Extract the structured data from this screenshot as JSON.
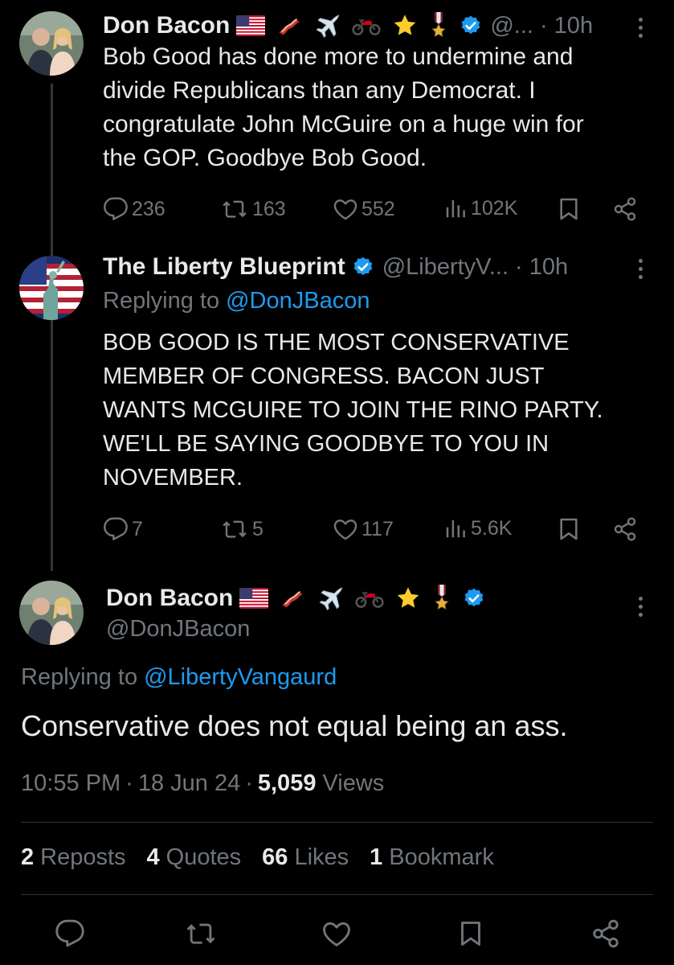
{
  "tweet1": {
    "name": "Don Bacon",
    "handle": "@...",
    "time": "· 10h",
    "text_lines": [
      "Bob Good has done more to undermine and",
      "divide Republicans than any Democrat. I",
      "congratulate John McGuire on a huge win for",
      "the GOP. Goodbye Bob Good."
    ],
    "replies": "236",
    "reposts": "163",
    "likes": "552",
    "views": "102K"
  },
  "tweet2": {
    "name": "The Liberty Blueprint",
    "handle": "@LibertyV...",
    "time": "· 10h",
    "replying_prefix": "Replying to",
    "replying_handle": "@DonJBacon",
    "text_lines": [
      "BOB GOOD IS THE MOST CONSERVATIVE",
      "MEMBER OF CONGRESS. BACON JUST",
      "WANTS MCGUIRE TO JOIN THE RINO PARTY.",
      "WE'LL BE SAYING GOODBYE TO YOU IN",
      "NOVEMBER."
    ],
    "replies": "7",
    "reposts": "5",
    "likes": "117",
    "views": "5.6K"
  },
  "main": {
    "name": "Don Bacon",
    "handle": "@DonJBacon",
    "replying_prefix": "Replying to",
    "replying_handle": "@LibertyVangaurd",
    "text": "Conservative does not equal being an ass.",
    "time": "10:55 PM",
    "date": "18 Jun 24",
    "views_count": "5,059",
    "views_label": "Views",
    "stats": {
      "reposts_count": "2",
      "reposts_label": "Reposts",
      "quotes_count": "4",
      "quotes_label": "Quotes",
      "likes_count": "66",
      "likes_label": "Likes",
      "bookmarks_count": "1",
      "bookmarks_label": "Bookmark"
    }
  },
  "icons": {
    "name_emojis": [
      "us-flag-icon",
      "bacon-icon",
      "airplane-icon",
      "motorcycle-icon",
      "star-icon",
      "military-medal-icon",
      "verified-badge-icon"
    ]
  },
  "colors": {
    "background": "#000000",
    "text": "#e7e9ea",
    "secondary": "#71767b",
    "accent": "#1d9bf0"
  }
}
